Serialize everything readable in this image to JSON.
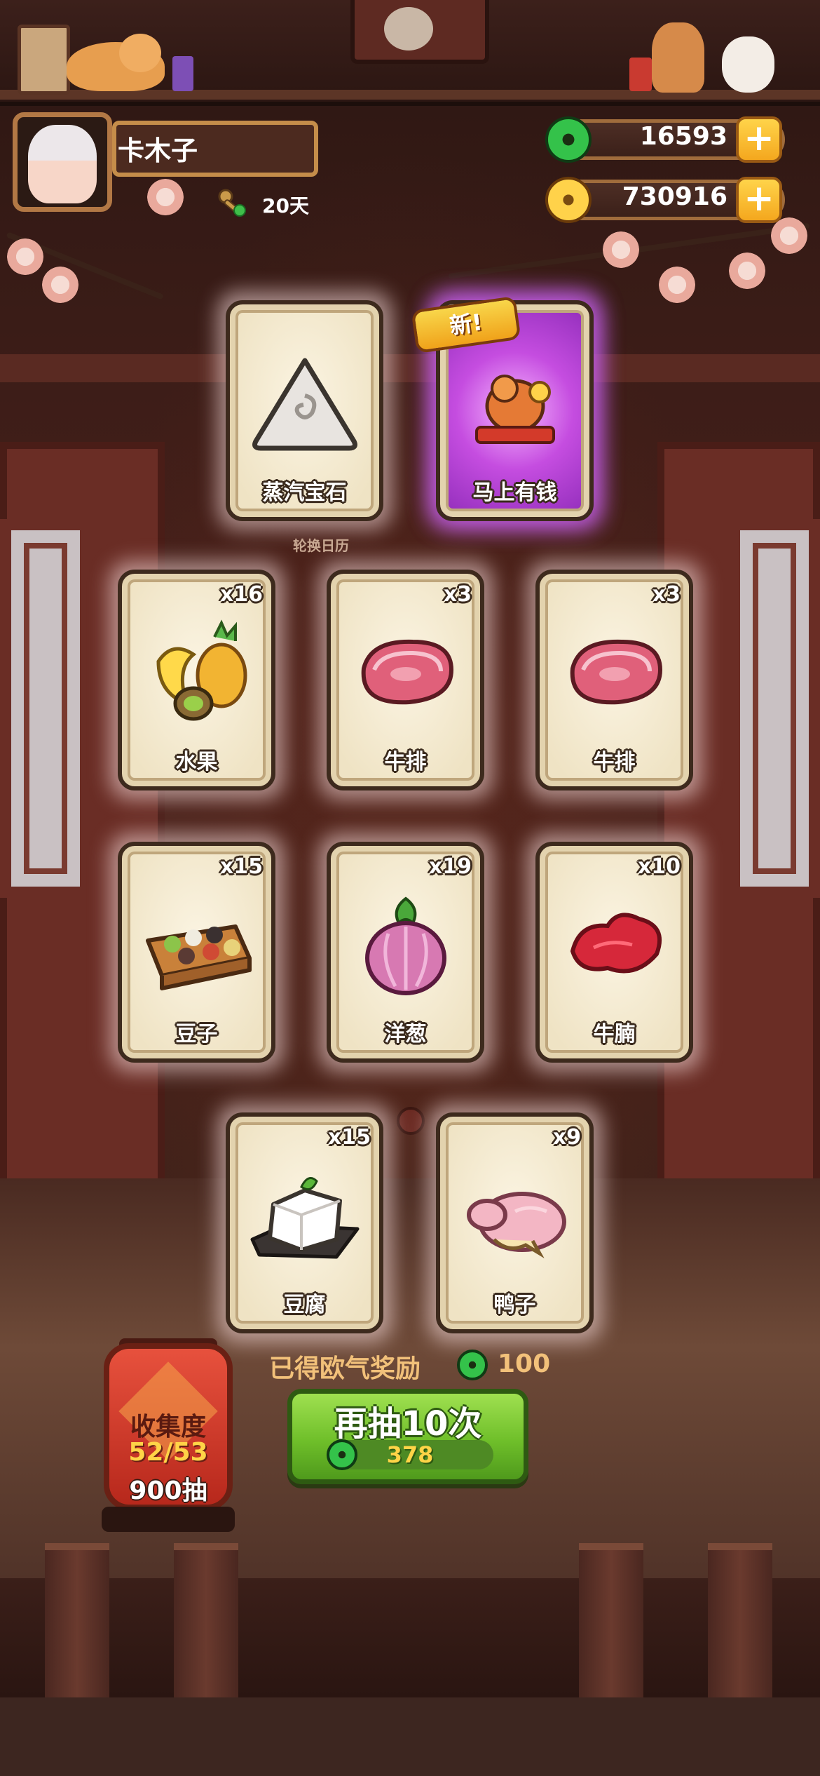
{
  "player": {
    "name": "卡木子",
    "days": "20天"
  },
  "currencies": {
    "jade": "16593",
    "coins": "730916"
  },
  "cards_row1_label": "轮换日历",
  "cards": [
    {
      "name": "蒸汽宝石",
      "qty": "",
      "icon": "steam-gem-icon"
    },
    {
      "name": "马上有钱",
      "qty": "",
      "icon": "horse-money-icon",
      "badge": "新!"
    },
    {
      "name": "水果",
      "qty": "x16",
      "icon": "fruit-icon"
    },
    {
      "name": "牛排",
      "qty": "x3",
      "icon": "steak-icon"
    },
    {
      "name": "牛排",
      "qty": "x3",
      "icon": "steak-icon"
    },
    {
      "name": "豆子",
      "qty": "x15",
      "icon": "beans-icon"
    },
    {
      "name": "洋葱",
      "qty": "x19",
      "icon": "onion-icon"
    },
    {
      "name": "牛腩",
      "qty": "x10",
      "icon": "beef-brisket-icon"
    },
    {
      "name": "豆腐",
      "qty": "x15",
      "icon": "tofu-icon"
    },
    {
      "name": "鸭子",
      "qty": "x9",
      "icon": "duck-icon"
    }
  ],
  "collection": {
    "title": "收集度",
    "progress": "52/53",
    "draws": "900抽"
  },
  "reward": {
    "label": "已得欧气奖励",
    "value": "100"
  },
  "draw_button": {
    "label": "再抽10次",
    "cost": "378"
  }
}
